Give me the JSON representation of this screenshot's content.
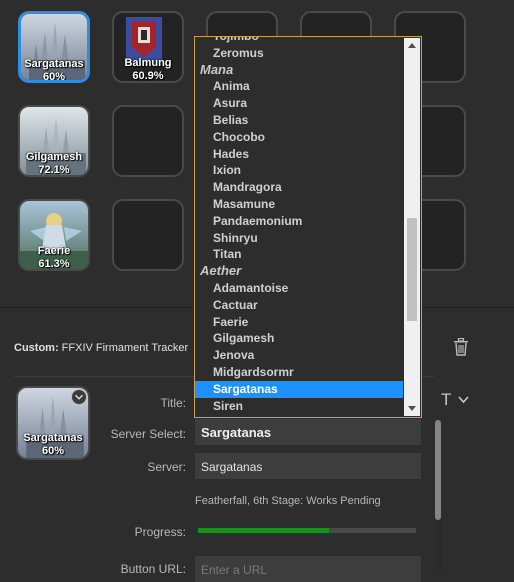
{
  "keys": [
    {
      "id": "sargatanas",
      "name": "Sargatanas",
      "percent": "60%",
      "selected": true
    },
    {
      "id": "balmung",
      "name": "Balmung",
      "percent": "60.9%",
      "selected": false
    },
    {
      "id": "gilgamesh",
      "name": "Gilgamesh",
      "percent": "72.1%",
      "selected": false
    },
    {
      "id": "faerie",
      "name": "Faerie",
      "percent": "61.3%",
      "selected": false
    }
  ],
  "inspector": {
    "custom_prefix": "Custom:",
    "plugin_name": "FFXIV Firmament Tracker",
    "preview_name": "Sargatanas",
    "preview_percent": "60%",
    "labels": {
      "title": "Title:",
      "server_select": "Server Select:",
      "server": "Server:",
      "progress": "Progress:",
      "button_url": "Button URL:"
    },
    "server_select_value": "Sargatanas",
    "server_value": "Sargatanas",
    "status_text": "Featherfall, 6th Stage: Works Pending",
    "progress_fraction": 0.6,
    "button_url_placeholder": "Enter a URL",
    "title_format_icon": "T",
    "trash_icon": "trash-icon"
  },
  "dropdown": {
    "items": [
      {
        "type": "item",
        "label": "Tojimbo"
      },
      {
        "type": "item",
        "label": "Zeromus"
      },
      {
        "type": "group",
        "label": "Mana"
      },
      {
        "type": "item",
        "label": "Anima"
      },
      {
        "type": "item",
        "label": "Asura"
      },
      {
        "type": "item",
        "label": "Belias"
      },
      {
        "type": "item",
        "label": "Chocobo"
      },
      {
        "type": "item",
        "label": "Hades"
      },
      {
        "type": "item",
        "label": "Ixion"
      },
      {
        "type": "item",
        "label": "Mandragora"
      },
      {
        "type": "item",
        "label": "Masamune"
      },
      {
        "type": "item",
        "label": "Pandaemonium"
      },
      {
        "type": "item",
        "label": "Shinryu"
      },
      {
        "type": "item",
        "label": "Titan"
      },
      {
        "type": "group",
        "label": "Aether"
      },
      {
        "type": "item",
        "label": "Adamantoise"
      },
      {
        "type": "item",
        "label": "Cactuar"
      },
      {
        "type": "item",
        "label": "Faerie"
      },
      {
        "type": "item",
        "label": "Gilgamesh"
      },
      {
        "type": "item",
        "label": "Jenova"
      },
      {
        "type": "item",
        "label": "Midgardsormr"
      },
      {
        "type": "item",
        "label": "Sargatanas",
        "selected": true
      },
      {
        "type": "item",
        "label": "Siren"
      }
    ]
  },
  "colors": {
    "accent": "#2f8de4",
    "selection": "#1e90ff",
    "progress": "#1b8f1b",
    "dropdown_border": "#c8a34a"
  }
}
